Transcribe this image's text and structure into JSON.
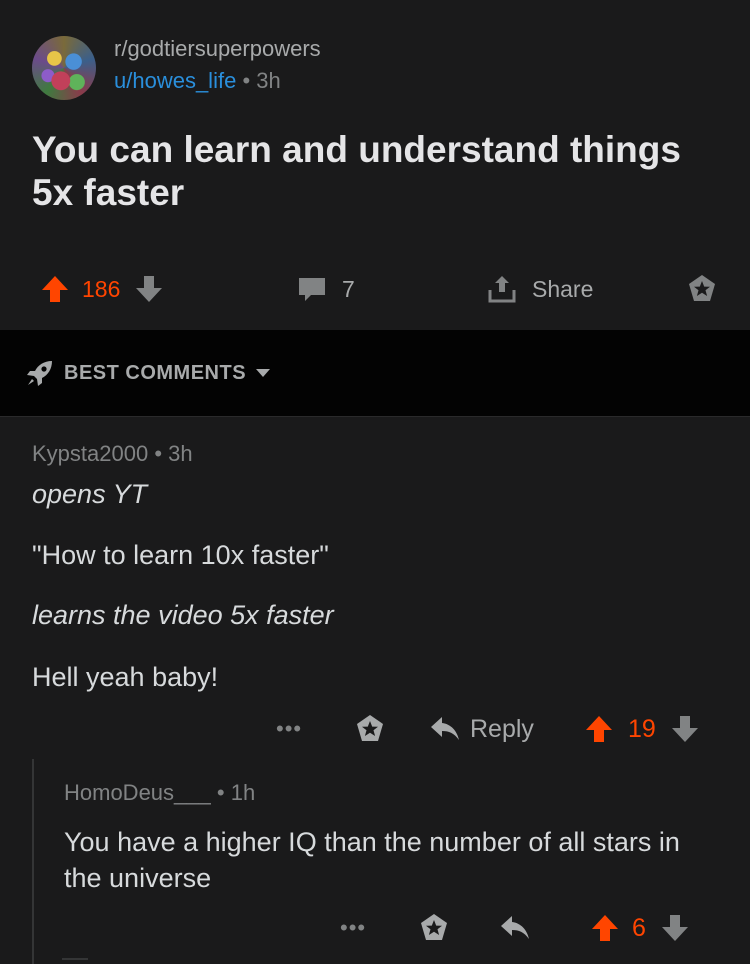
{
  "post": {
    "subreddit": "r/godtiersuperpowers",
    "author": "u/howes_life",
    "age": "3h",
    "title": "You can learn and understand things 5x faster",
    "score": "186",
    "comments": "7",
    "share_label": "Share"
  },
  "sort": {
    "label": "BEST COMMENTS"
  },
  "comments": [
    {
      "author": "Kypsta2000",
      "age": "3h",
      "lines": [
        "opens YT",
        "\"How to learn 10x faster\"",
        "learns the video 5x faster",
        "Hell yeah baby!"
      ],
      "more": "•••",
      "reply_label": "Reply",
      "score": "19"
    },
    {
      "author": "HomoDeus___",
      "age": "1h",
      "body": "You have a higher IQ than the number of all stars in the universe",
      "more": "•••",
      "score": "6"
    }
  ],
  "colors": {
    "background": "#1a1a1b",
    "sort_bar": "#030303",
    "upvote": "#ff4500",
    "username_link": "#2a8fdc",
    "muted": "#818384"
  },
  "icons": [
    "avatar",
    "upvote-arrow-icon",
    "downvote-arrow-icon",
    "comment-bubble-icon",
    "share-icon",
    "award-star-icon",
    "rocket-icon",
    "caret-down-icon",
    "more-dots-icon",
    "reply-arrow-icon"
  ]
}
